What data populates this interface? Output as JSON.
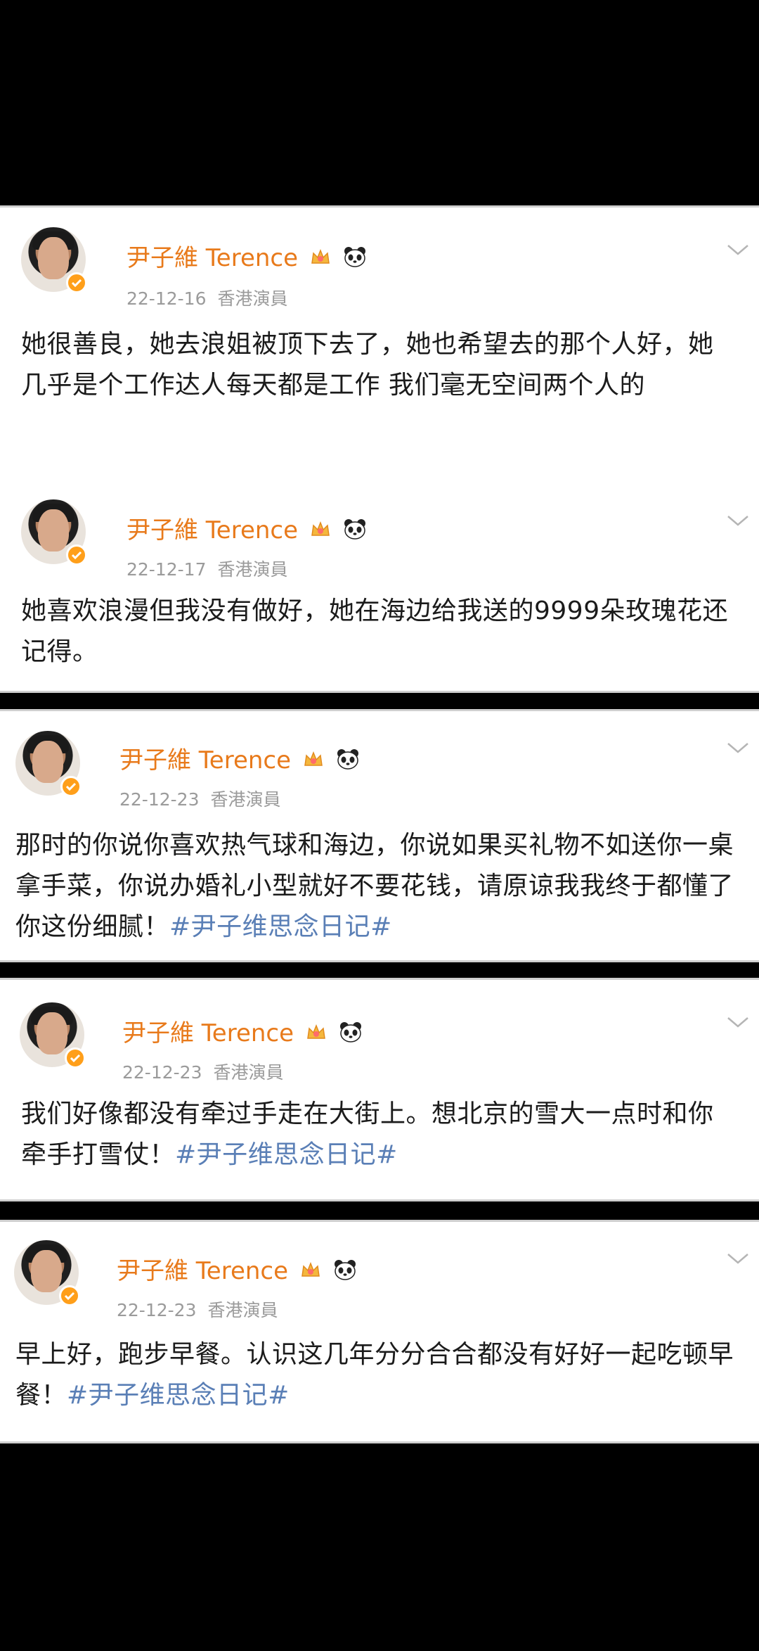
{
  "user": {
    "name": "尹子維 Terence",
    "location": "香港演員",
    "crown_icon": "crown-badge-icon",
    "panda_icon": "panda-icon",
    "name_color": "#e87a1b",
    "hashtag_color": "#5a7fb6"
  },
  "posts": [
    {
      "date": "22-12-16",
      "text": "她很善良，她去浪姐被顶下去了，她也希望去的那个人好，她几乎是个工作达人每天都是工作 我们毫无空间两个人的",
      "hashtag": ""
    },
    {
      "date": "22-12-17",
      "text": "她喜欢浪漫但我没有做好，她在海边给我送的9999朵玫瑰花还记得。",
      "hashtag": ""
    },
    {
      "date": "22-12-23",
      "text": "那时的你说你喜欢热气球和海边，你说如果买礼物不如送你一桌拿手菜，你说办婚礼小型就好不要花钱，请原谅我我终于都懂了你这份细腻！",
      "hashtag": "#尹子维思念日记#"
    },
    {
      "date": "22-12-23",
      "text": "我们好像都没有牵过手走在大街上。想北京的雪大一点时和你牵手打雪仗！",
      "hashtag": "#尹子维思念日记#"
    },
    {
      "date": "22-12-23",
      "text": "早上好，跑步早餐。认识这几年分分合合都没有好好一起吃顿早餐！",
      "hashtag": "#尹子维思念日记#"
    }
  ]
}
